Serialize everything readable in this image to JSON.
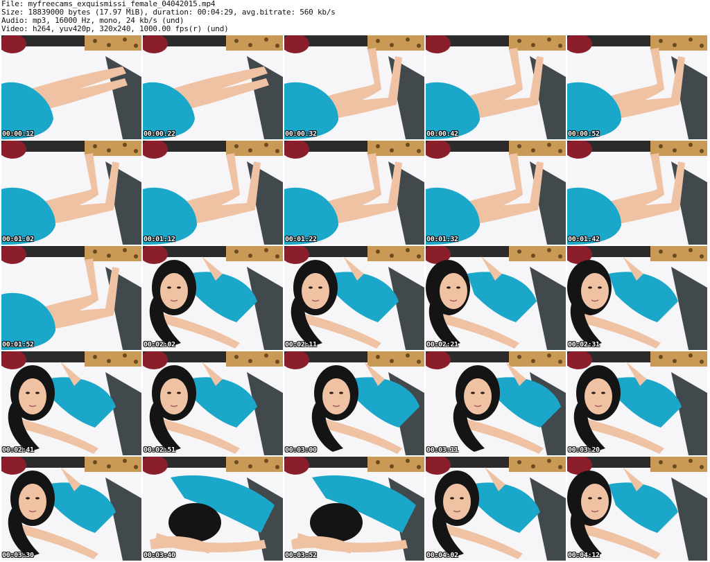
{
  "header": {
    "file": "File: myfreecams_exquismissi_female_04042015.mp4",
    "size": "Size: 18839000 bytes (17.97 MiB), duration: 00:04:29, avg.bitrate: 560 kb/s",
    "audio": "Audio: mp3, 16000 Hz, mono, 24 kb/s (und)",
    "video": "Video: h264, yuv420p, 320x240, 1000.00 fps(r) (und)"
  },
  "colors": {
    "bed": "#f6f6f8",
    "headboard": "#2b2b2b",
    "leopard": "#c99a55",
    "pillow_red": "#8a1e2a",
    "dress": "#1aa7c9",
    "skin": "#f0c2a4",
    "hair": "#141414"
  },
  "thumbnails": [
    {
      "time": "00:00:12",
      "scene": "legs"
    },
    {
      "time": "00:00:22",
      "scene": "legs"
    },
    {
      "time": "00:00:32",
      "scene": "legs-up"
    },
    {
      "time": "00:00:42",
      "scene": "legs-up"
    },
    {
      "time": "00:00:52",
      "scene": "legs-up"
    },
    {
      "time": "00:01:02",
      "scene": "legs-up"
    },
    {
      "time": "00:01:12",
      "scene": "legs-up"
    },
    {
      "time": "00:01:22",
      "scene": "legs-up"
    },
    {
      "time": "00:01:32",
      "scene": "legs-up"
    },
    {
      "time": "00:01:42",
      "scene": "legs-up"
    },
    {
      "time": "00:01:52",
      "scene": "legs-up"
    },
    {
      "time": "00:02:02",
      "scene": "face"
    },
    {
      "time": "00:02:11",
      "scene": "face"
    },
    {
      "time": "00:02:21",
      "scene": "face-side"
    },
    {
      "time": "00:02:31",
      "scene": "face-side"
    },
    {
      "time": "00:02:41",
      "scene": "face"
    },
    {
      "time": "00:02:51",
      "scene": "face"
    },
    {
      "time": "00:03:00",
      "scene": "face-center"
    },
    {
      "time": "00:03:11",
      "scene": "face-center"
    },
    {
      "time": "00:03:20",
      "scene": "face"
    },
    {
      "time": "00:03:30",
      "scene": "face"
    },
    {
      "time": "00:03:40",
      "scene": "head-down"
    },
    {
      "time": "00:03:52",
      "scene": "head-down"
    },
    {
      "time": "00:04:02",
      "scene": "face"
    },
    {
      "time": "00:04:12",
      "scene": "face-side"
    }
  ]
}
